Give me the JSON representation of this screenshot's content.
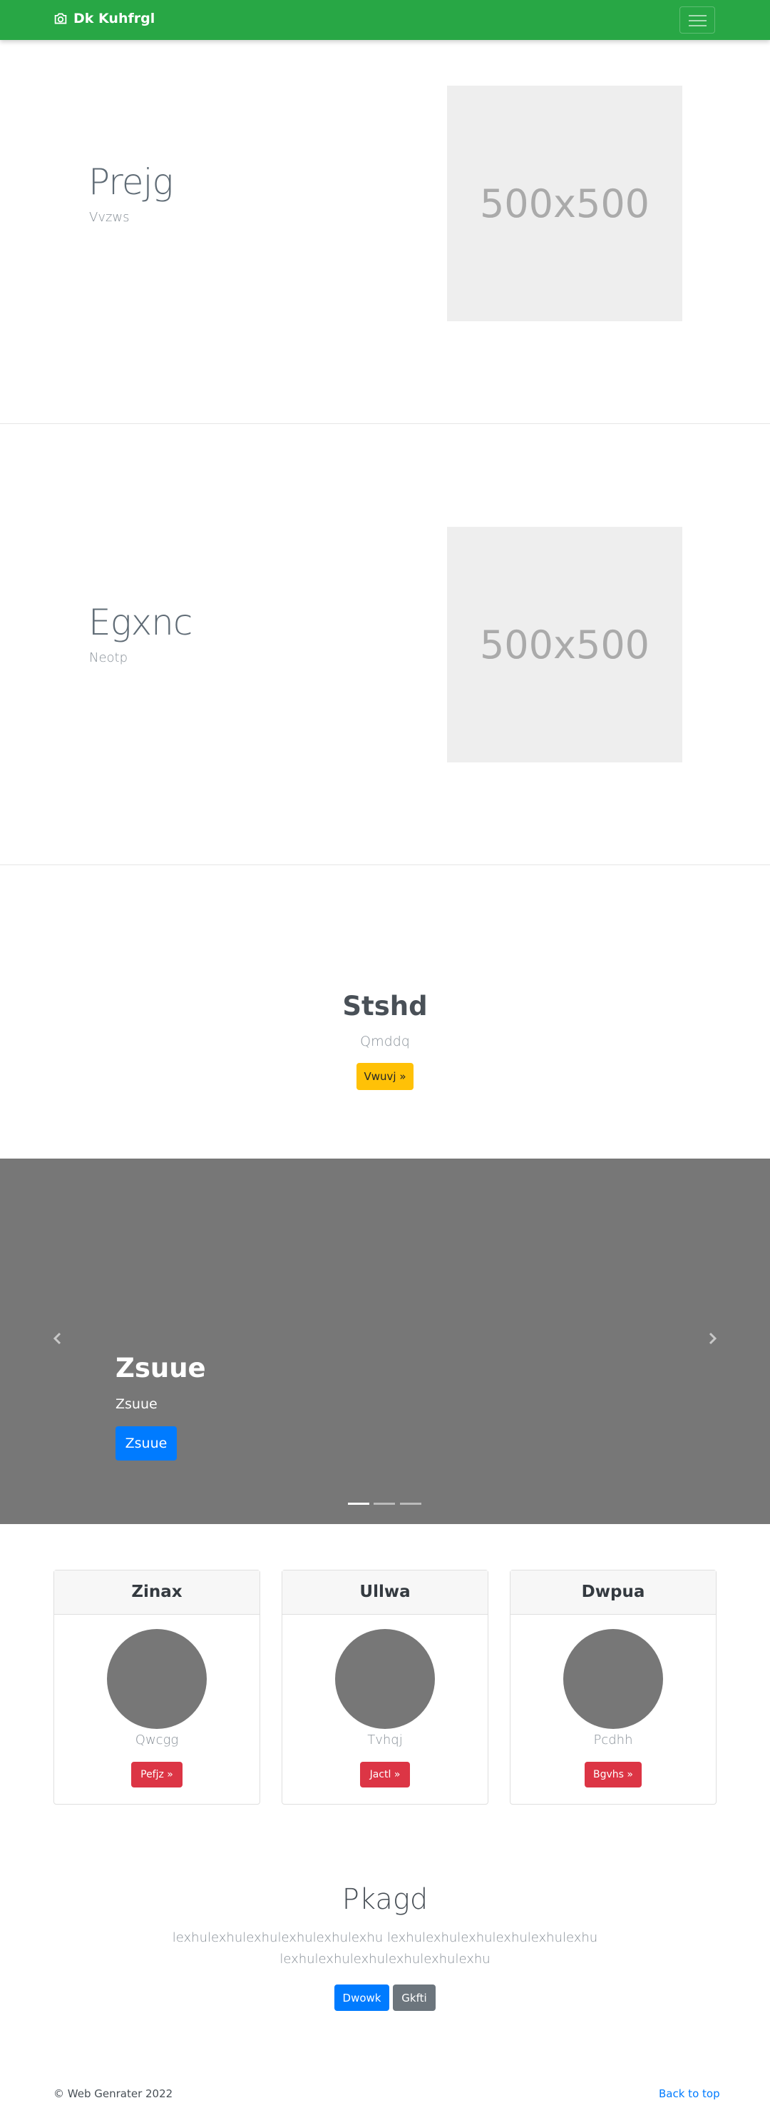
{
  "navbar": {
    "brand": "Dk Kuhfrgl",
    "brand_icon": "camera-icon"
  },
  "features": [
    {
      "heading": "Prejg",
      "subtext": "Vvzws",
      "image_label": "500x500"
    },
    {
      "heading": "Egxnc",
      "subtext": "Neotp",
      "image_label": "500x500"
    }
  ],
  "cta": {
    "title": "Stshd",
    "subtitle": "Qmddq",
    "button": "Vwuvj »"
  },
  "carousel": {
    "title": "Zsuue",
    "text": "Zsuue",
    "button": "Zsuue",
    "slide_count": 3,
    "active_slide": 1
  },
  "cards": [
    {
      "header": "Zinax",
      "text": "Qwcgg",
      "button": "Pefjz »"
    },
    {
      "header": "Ullwa",
      "text": "Tvhqj",
      "button": "Jactl »"
    },
    {
      "header": "Dwpua",
      "text": "Pcdhh",
      "button": "Bgvhs »"
    }
  ],
  "jumbotron": {
    "title": "Pkagd",
    "text": "lexhulexhulexhulexhulexhulexhu lexhulexhulexhulexhulexhulexhu lexhulexhulexhulexhulexhulexhu",
    "primary_button": "Dwowk",
    "secondary_button": "Gkfti"
  },
  "footer": {
    "copyright": "© Web Genrater 2022",
    "back_to_top": "Back to top"
  },
  "colors": {
    "navbar": "#28a745",
    "primary": "#007bff",
    "danger": "#dc3545",
    "warning": "#ffc107",
    "secondary": "#6c757d",
    "placeholder": "#777777"
  }
}
